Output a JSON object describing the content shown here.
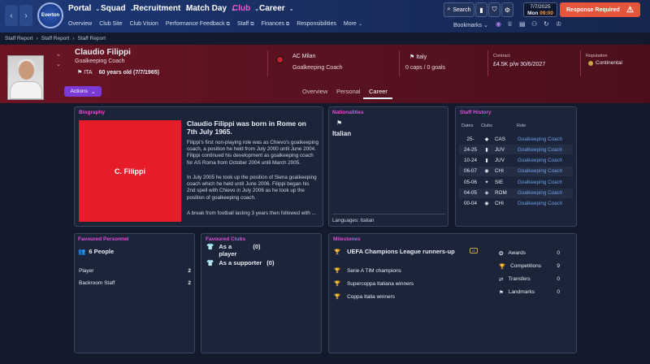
{
  "topbar": {
    "crest_text": "Everton",
    "menus": [
      {
        "label": "Portal"
      },
      {
        "label": "Squad"
      },
      {
        "label": "Recruitment"
      },
      {
        "label": "Match Day"
      },
      {
        "label": "Club"
      },
      {
        "label": "Career"
      }
    ],
    "submenu": [
      "Overview",
      "Club Site",
      "Club Vision",
      "Performance Feedback",
      "Staff",
      "Finances",
      "Responsibilities",
      "More"
    ],
    "search_label": "Search",
    "date": "7/7/2025",
    "day": "Mon",
    "time": "09:00",
    "response_label": "Response Required",
    "bookmarks_label": "Bookmarks",
    "accent_color": "#ff4fd0",
    "alert_color": "#e5553b"
  },
  "breadcrumb": [
    "Staff Report",
    "Staff Report",
    "Staff Report"
  ],
  "profile": {
    "name": "Claudio Filippi",
    "role": "Goalkeeping Coach",
    "nationality_code": "ITA",
    "age": "60 years old (7/7/1965)",
    "club": "AC Milan",
    "club_role": "Goalkeeping Coach",
    "nation": "Italy",
    "caps": "0 caps / 0 goals",
    "contract_label": "Contract",
    "contract_value": "£4.5K p/w 30/6/2027",
    "reputation_label": "Reputation",
    "reputation_value": "Continental",
    "actions_label": "Actions",
    "tabs": [
      "Overview",
      "Personal",
      "Career"
    ]
  },
  "biography": {
    "title": "Biography",
    "image_label": "C. Filippi",
    "heading": "Claudio Filippi was born in Rome on 7th July 1965.",
    "p1": "Filippi's first non-playing role was as Chievo's goalkeeping coach, a position he held from July 2000 until June 2004. Filippi continued his development as goalkeeping coach for AS Roma from October 2004 until March 2005.",
    "p2": "In July 2005 he took up the position of Siena goalkeeping coach which he held until June 2006. Filippi began his 2nd spell with Chievo in July 2006 as he took up the position of goalkeeping coach.",
    "p3": "A break from football lasting 3 years then followed with ..."
  },
  "nationalities": {
    "title": "Nationalities",
    "nation": "Italian",
    "languages": "Languages: Italian"
  },
  "staff_history": {
    "title": "Staff History",
    "headers": [
      "Dates",
      "Clubs",
      "Role"
    ],
    "rows": [
      {
        "dates": "25-",
        "club": "CAS",
        "role": "Goalkeeping Coach"
      },
      {
        "dates": "24-25",
        "club": "JUV",
        "role": "Goalkeeping Coach"
      },
      {
        "dates": "10-24",
        "club": "JUV",
        "role": "Goalkeeping Coach"
      },
      {
        "dates": "06-07",
        "club": "CHI",
        "role": "Goalkeeping Coach"
      },
      {
        "dates": "05-06",
        "club": "SIE",
        "role": "Goalkeeping Coach"
      },
      {
        "dates": "04-05",
        "club": "ROM",
        "role": "Goalkeeping Coach"
      },
      {
        "dates": "00-04",
        "club": "CHI",
        "role": "Goalkeeping Coach"
      }
    ]
  },
  "favoured_personnel": {
    "title": "Favoured Personnel",
    "people": "6 People",
    "rows": [
      {
        "label": "Player",
        "count": "2"
      },
      {
        "label": "Backroom Staff",
        "count": "2"
      }
    ]
  },
  "favoured_clubs": {
    "title": "Favoured Clubs",
    "player_label": "As a player",
    "player_count": "(0)",
    "supporter_label": "As a supporter",
    "supporter_count": "(0)"
  },
  "milestones": {
    "title": "Milestones",
    "top": "UEFA Champions League runners-up",
    "badge": "x1",
    "items": [
      "Serie A TIM champions",
      "Supercoppa Italiana winners",
      "Coppa Italia winners"
    ],
    "stats": [
      {
        "label": "Awards",
        "value": "0"
      },
      {
        "label": "Competitions",
        "value": "9"
      },
      {
        "label": "Transfers",
        "value": "0"
      },
      {
        "label": "Landmarks",
        "value": "0"
      }
    ]
  }
}
